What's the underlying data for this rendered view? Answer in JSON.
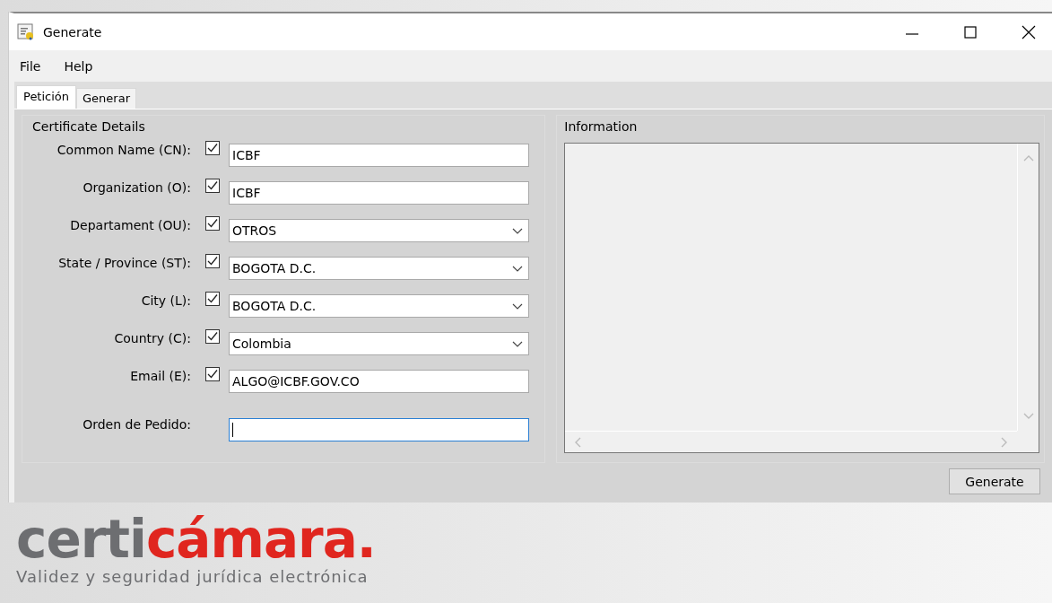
{
  "window": {
    "title": "Generate"
  },
  "menu": [
    "File",
    "Help"
  ],
  "tabs": [
    {
      "label": "Petición",
      "selected": true
    },
    {
      "label": "Generar",
      "selected": false
    }
  ],
  "certificate_details": {
    "title": "Certificate Details",
    "fields": [
      {
        "label": "Common Name (CN):",
        "checked": true,
        "kind": "text",
        "value": "ICBF"
      },
      {
        "label": "Organization (O):",
        "checked": true,
        "kind": "text",
        "value": "ICBF"
      },
      {
        "label": "Departament (OU):",
        "checked": true,
        "kind": "dropdown",
        "value": "OTROS"
      },
      {
        "label": "State / Province (ST):",
        "checked": true,
        "kind": "dropdown",
        "value": "BOGOTA D.C."
      },
      {
        "label": "City (L):",
        "checked": true,
        "kind": "dropdown",
        "value": "BOGOTA D.C."
      },
      {
        "label": "Country (C):",
        "checked": true,
        "kind": "dropdown",
        "value": "Colombia"
      },
      {
        "label": "Email (E):",
        "checked": true,
        "kind": "text",
        "value": "ALGO@ICBF.GOV.CO"
      }
    ],
    "order": {
      "label": "Orden de Pedido:",
      "focused": true
    }
  },
  "information": {
    "title": "Information"
  },
  "buttons": [
    "Generate"
  ],
  "logo": {
    "grey_part": "certi",
    "red_part": "cámara.",
    "tagline": "Validez y seguridad jurídica electrónica"
  }
}
